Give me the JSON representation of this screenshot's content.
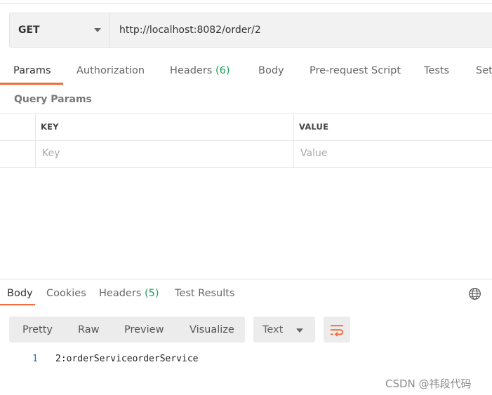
{
  "request": {
    "method": "GET",
    "url": "http://localhost:8082/order/2"
  },
  "request_tabs": {
    "params": "Params",
    "authorization": "Authorization",
    "headers": "Headers",
    "headers_count": "(6)",
    "body": "Body",
    "prerequest": "Pre-request Script",
    "tests": "Tests",
    "settings": "Set"
  },
  "query_params": {
    "title": "Query Params",
    "col_key": "KEY",
    "col_value": "VALUE",
    "key_placeholder": "Key",
    "value_placeholder": "Value"
  },
  "response_tabs": {
    "body": "Body",
    "cookies": "Cookies",
    "headers": "Headers",
    "headers_count": "(5)",
    "test_results": "Test Results"
  },
  "view": {
    "pretty": "Pretty",
    "raw": "Raw",
    "preview": "Preview",
    "visualize": "Visualize",
    "format": "Text"
  },
  "response_body": {
    "line_number": "1",
    "line_text": "2:orderServiceorderService"
  },
  "watermark": "CSDN @祎段代码",
  "colors": {
    "accent": "#f26b3a",
    "count_green": "#1f9f5a",
    "line_number_blue": "#2f6fb8"
  }
}
